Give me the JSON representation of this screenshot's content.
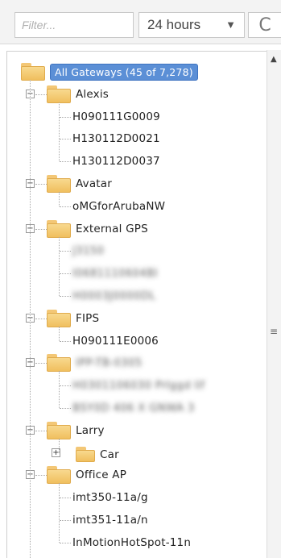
{
  "toolbar": {
    "filter_placeholder": "Filter...",
    "time_range": "24 hours",
    "time_range_caret": "▼",
    "refresh_glyph": "C"
  },
  "tree": {
    "root": {
      "label": "All Gateways (45 of 7,278)"
    },
    "groups": [
      {
        "label": "Alexis",
        "items": [
          "H090111G0009",
          "H130112D0021",
          "H130112D0037"
        ]
      },
      {
        "label": "Avatar",
        "items": [
          "oMGforArubaNW"
        ]
      },
      {
        "label": "External GPS",
        "items": [
          "J3150",
          "I0681110604BI",
          "H0003J0000DL"
        ]
      },
      {
        "label": "FIPS",
        "items": [
          "H090111E0006"
        ]
      },
      {
        "label": "IPP-TB-0305",
        "items": [
          "H0301106030 Prlggd lif",
          "BSY0D 406 X GNWA 3"
        ]
      },
      {
        "label": "Larry",
        "children": [
          {
            "label": "Car"
          }
        ]
      },
      {
        "label": "Office AP",
        "items": [
          "imt350-11a/g",
          "imt351-11a/n",
          "InMotionHotSpot-11n"
        ]
      }
    ],
    "minus": "−",
    "plus": "+"
  },
  "scrollbar": {
    "up": "▲",
    "grip": "≡"
  }
}
